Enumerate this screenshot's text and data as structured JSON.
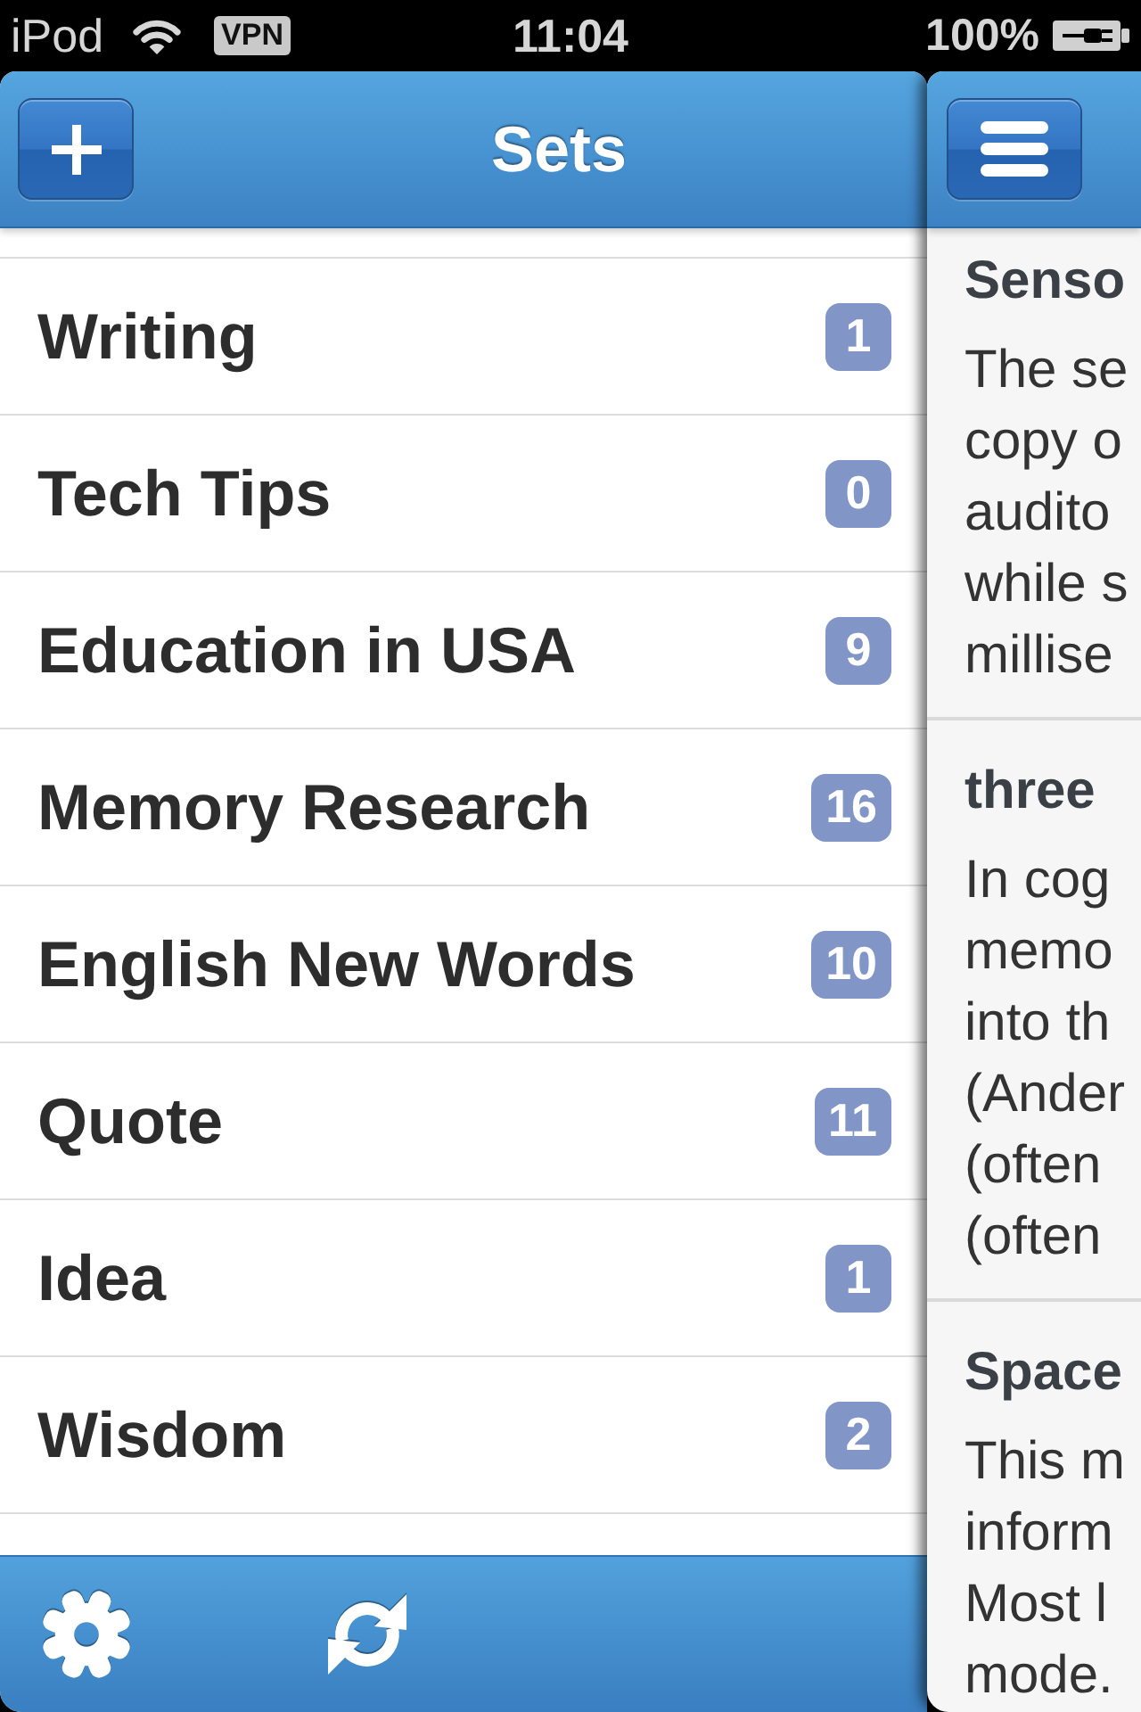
{
  "status_bar": {
    "carrier": "iPod",
    "vpn_label": "VPN",
    "time": "11:04",
    "battery_percent": "100%"
  },
  "sets_panel": {
    "title": "Sets",
    "sets": [
      {
        "name": "Writing",
        "count": "1"
      },
      {
        "name": "Tech Tips",
        "count": "0"
      },
      {
        "name": "Education in USA",
        "count": "9"
      },
      {
        "name": "Memory Research",
        "count": "16"
      },
      {
        "name": "English New Words",
        "count": "10"
      },
      {
        "name": "Quote",
        "count": "11"
      },
      {
        "name": "Idea",
        "count": "1"
      },
      {
        "name": "Wisdom",
        "count": "2"
      }
    ]
  },
  "detail_panel": {
    "notes": [
      {
        "title": "Senso",
        "lines": [
          "The se",
          "copy o",
          "audito",
          "while s",
          "millise"
        ]
      },
      {
        "title": "three",
        "lines": [
          "In cog",
          "memo",
          "into th",
          "(Ander",
          "(often",
          "(often"
        ]
      },
      {
        "title": "Space",
        "lines": [
          "This m",
          "inform",
          "Most l",
          "mode."
        ]
      }
    ]
  }
}
